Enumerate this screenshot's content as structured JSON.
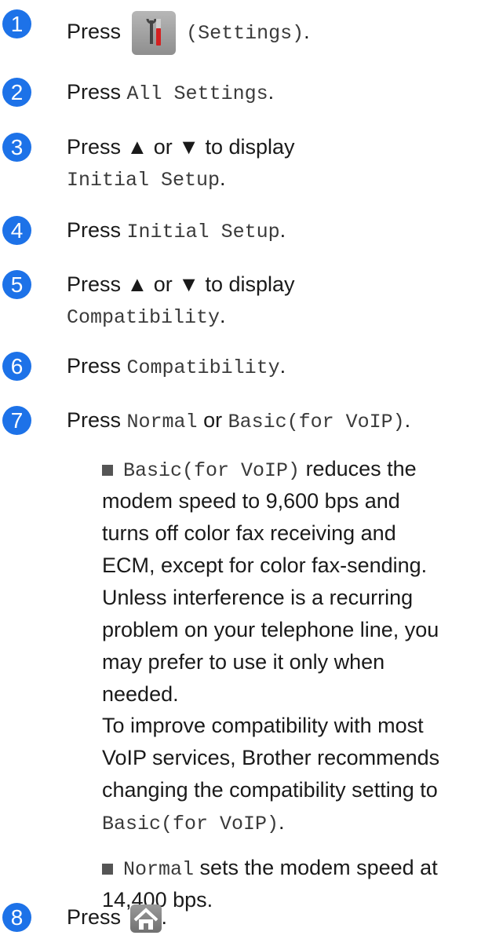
{
  "steps": [
    {
      "number": "1",
      "press": "Press",
      "code": "(Settings)",
      "end": "."
    },
    {
      "number": "2",
      "press": "Press",
      "code": "All Settings",
      "end": "."
    },
    {
      "number": "3",
      "line1": "Press ▲ or ▼ to display",
      "code": "Initial Setup",
      "end": "."
    },
    {
      "number": "4",
      "press": "Press",
      "code": "Initial Setup",
      "end": "."
    },
    {
      "number": "5",
      "line1": "Press ▲ or ▼ to display",
      "code": "Compatibility",
      "end": "."
    },
    {
      "number": "6",
      "press": "Press",
      "code": "Compatibility",
      "end": "."
    },
    {
      "number": "7",
      "press": "Press",
      "code_a": "Normal",
      "or": "or",
      "code_b": "Basic(for VoIP)",
      "end": "."
    },
    {
      "number": "8",
      "press": "Press",
      "end": "."
    }
  ],
  "bullets": [
    {
      "code": "Basic(for VoIP)",
      "lines": [
        "reduces the",
        "modem speed to 9,600 bps and",
        "turns off color fax receiving and",
        "ECM, except for color fax-sending.",
        "Unless interference is a recurring",
        "problem on your telephone line, you",
        "may prefer to use it only when",
        "needed."
      ],
      "note_lines": [
        "To improve compatibility with most",
        "VoIP services, Brother recommends",
        "changing the compatibility setting to"
      ],
      "note_code": "Basic(for VoIP)",
      "note_end": "."
    },
    {
      "code": "Normal",
      "lines": [
        "sets the modem speed at",
        "14,400 bps."
      ]
    }
  ],
  "icons": {
    "settings": "settings-icon",
    "home": "home-icon"
  },
  "colors": {
    "badge": "#1d72e8"
  }
}
